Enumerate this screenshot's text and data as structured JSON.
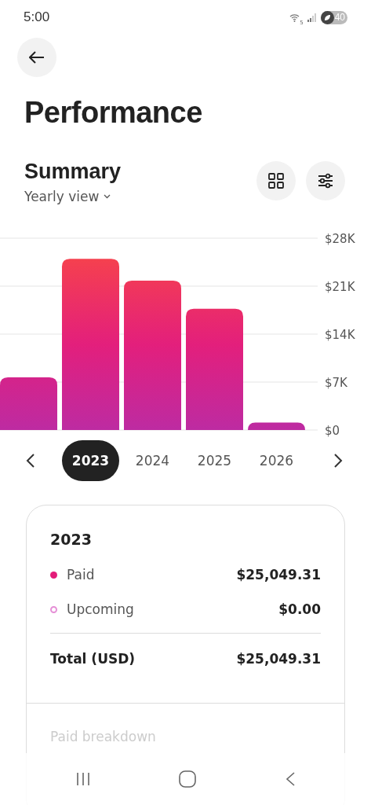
{
  "status_bar": {
    "time": "5:00",
    "wifi_badge": "5",
    "battery": "40"
  },
  "title": "Performance",
  "summary": {
    "heading": "Summary",
    "view_selector": "Yearly view"
  },
  "chart": {
    "chart_data": {
      "type": "bar",
      "grid": true,
      "values": [
        7700,
        25000,
        21800,
        17700,
        1100
      ],
      "ylim": [
        0,
        28000
      ],
      "yticks": [
        {
          "value": 0,
          "label": "$0"
        },
        {
          "value": 7000,
          "label": "$7K"
        },
        {
          "value": 14000,
          "label": "$14K"
        },
        {
          "value": 21000,
          "label": "$21K"
        },
        {
          "value": 28000,
          "label": "$28K"
        }
      ]
    }
  },
  "year_tabs": {
    "items": [
      {
        "label": "2023",
        "selected": true
      },
      {
        "label": "2024",
        "selected": false
      },
      {
        "label": "2025",
        "selected": false
      },
      {
        "label": "2026",
        "selected": false
      }
    ]
  },
  "card": {
    "year": "2023",
    "rows": [
      {
        "label": "Paid",
        "value": "$25,049.31",
        "kind": "filled",
        "color": "#e31c79"
      },
      {
        "label": "Upcoming",
        "value": "$0.00",
        "kind": "outline",
        "color": "#e58fd6"
      }
    ],
    "total_label": "Total (USD)",
    "total_value": "$25,049.31",
    "section": "Paid breakdown"
  }
}
